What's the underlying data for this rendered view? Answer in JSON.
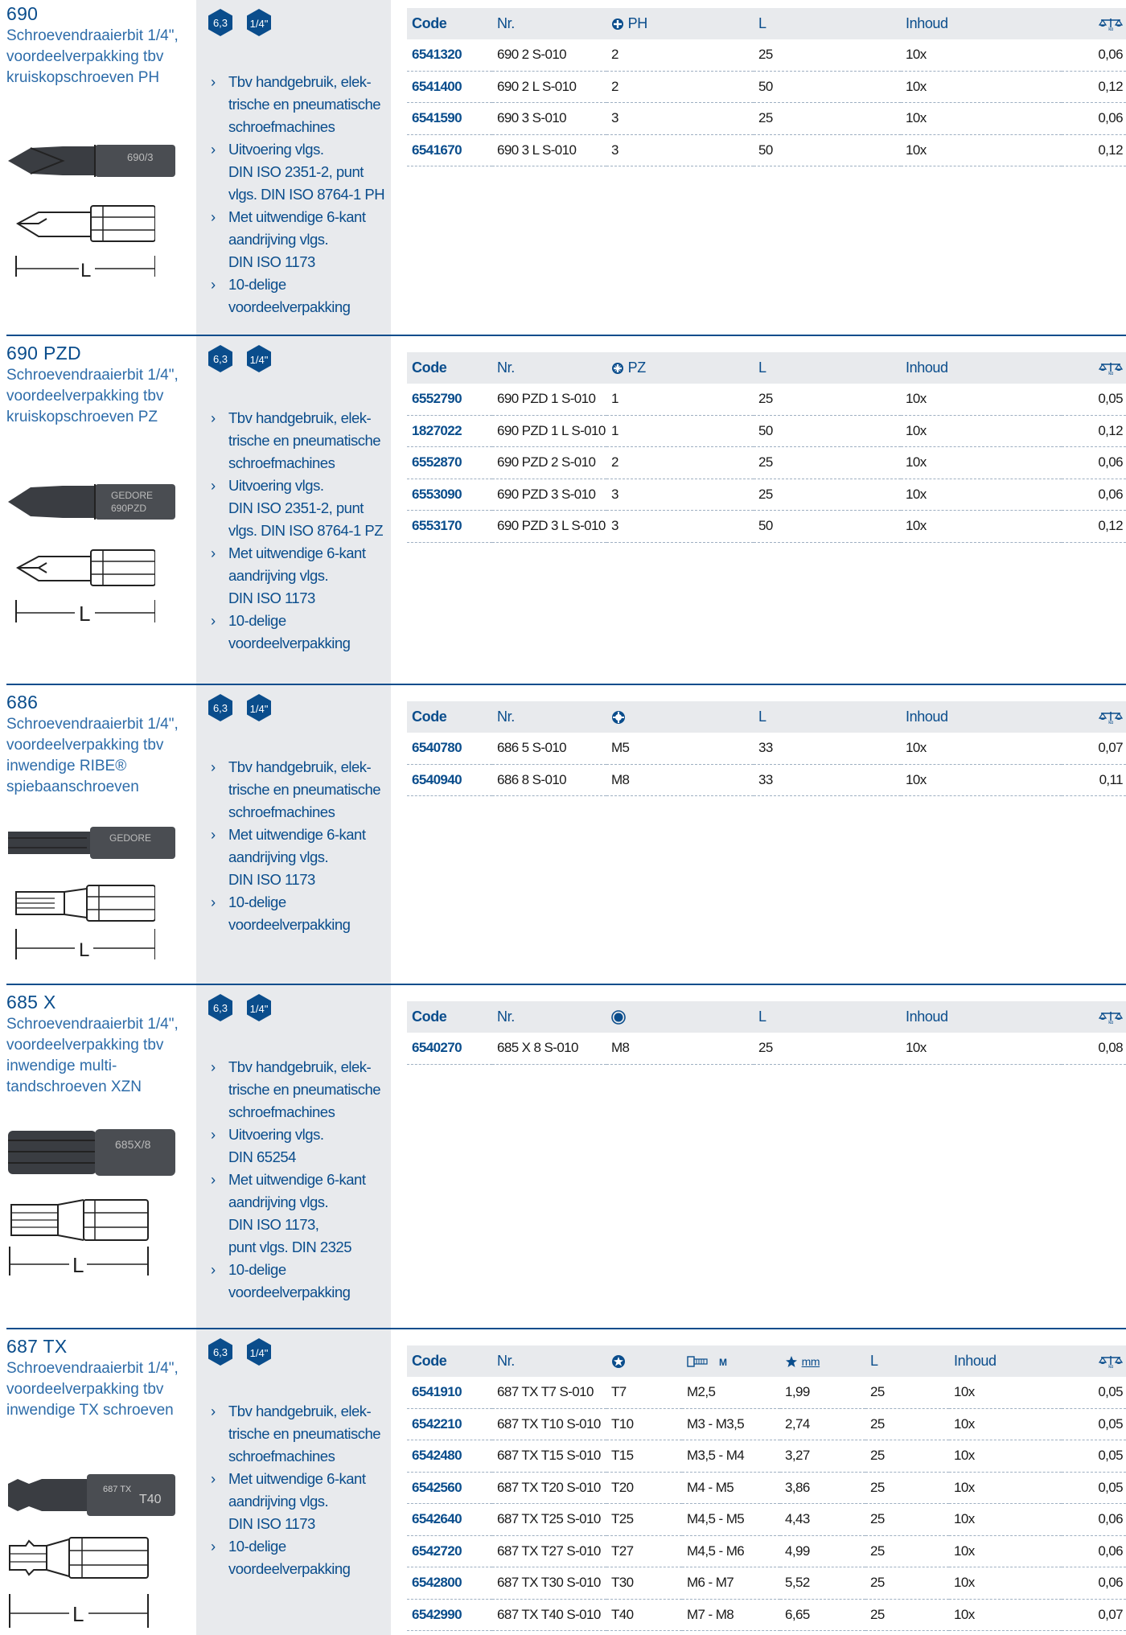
{
  "colors": {
    "brand_blue": "#0a4d8c",
    "panel_gray": "#e8eaed",
    "desc_blue": "#2d6ca9"
  },
  "sections": [
    {
      "title": "690",
      "description": "Schroevendraaierbit 1/4\", voordeelverpakking tbv kruiskopschroeven PH",
      "badges": [
        "6,3",
        "1/4\""
      ],
      "bullets": [
        "Tbv handgebruik, elek-\ntrische en pneumatische\nschroefmachines",
        "Uitvoering vlgs.\nDIN ISO 2351-2, punt\nvlgs. DIN ISO 8764-1 PH",
        "Met uitwendige 6-kant\naandrijving vlgs.\nDIN ISO 1173",
        "10-delige\nvoordeelverpakking"
      ],
      "drawing_label": "L",
      "headers": [
        "Code",
        "Nr.",
        "PH",
        "L",
        "Inhoud"
      ],
      "size_icon": "phillips-cross-icon",
      "weight_icon": "scale-kg-icon",
      "rows": [
        [
          "6541320",
          "690 2 S-010",
          "2",
          "25",
          "10x",
          "0,06"
        ],
        [
          "6541400",
          "690 2 L S-010",
          "2",
          "50",
          "10x",
          "0,12"
        ],
        [
          "6541590",
          "690 3 S-010",
          "3",
          "25",
          "10x",
          "0,06"
        ],
        [
          "6541670",
          "690 3 L S-010",
          "3",
          "50",
          "10x",
          "0,12"
        ]
      ]
    },
    {
      "title": "690 PZD",
      "description": "Schroevendraaierbit 1/4\", voordeelverpakking tbv kruiskopschroeven PZ",
      "badges": [
        "6,3",
        "1/4\""
      ],
      "bullets": [
        "Tbv handgebruik, elek-\ntrische en pneumatische\nschroefmachines",
        "Uitvoering vlgs.\nDIN ISO 2351-2, punt\nvlgs. DIN ISO 8764-1 PZ",
        "Met uitwendige 6-kant\naandrijving vlgs.\nDIN ISO 1173",
        "10-delige\nvoordeelverpakking"
      ],
      "drawing_label": "L",
      "headers": [
        "Code",
        "Nr.",
        "PZ",
        "L",
        "Inhoud"
      ],
      "size_icon": "pozidriv-cross-icon",
      "weight_icon": "scale-kg-icon",
      "rows": [
        [
          "6552790",
          "690 PZD 1 S-010",
          "1",
          "25",
          "10x",
          "0,05"
        ],
        [
          "1827022",
          "690 PZD 1 L S-010",
          "1",
          "50",
          "10x",
          "0,12"
        ],
        [
          "6552870",
          "690 PZD 2 S-010",
          "2",
          "25",
          "10x",
          "0,06"
        ],
        [
          "6553090",
          "690 PZD 3 S-010",
          "3",
          "25",
          "10x",
          "0,06"
        ],
        [
          "6553170",
          "690 PZD 3 L S-010",
          "3",
          "50",
          "10x",
          "0,12"
        ]
      ]
    },
    {
      "title": "686",
      "description": "Schroevendraaierbit 1/4\", voordeelverpakking tbv inwendige RIBE® spiebaanschroeven",
      "badges": [
        "6,3",
        "1/4\""
      ],
      "bullets": [
        "Tbv handgebruik, elek-\ntrische en pneumatische\nschroefmachines",
        "Met uitwendige 6-kant\naandrijving vlgs.\nDIN ISO 1173",
        "10-delige\nvoordeelverpakking"
      ],
      "drawing_label": "L",
      "headers": [
        "Code",
        "Nr.",
        "",
        "L",
        "Inhoud"
      ],
      "size_icon": "ribe-spline-icon",
      "weight_icon": "scale-kg-icon",
      "rows": [
        [
          "6540780",
          "686 5 S-010",
          "M5",
          "33",
          "10x",
          "0,07"
        ],
        [
          "6540940",
          "686 8 S-010",
          "M8",
          "33",
          "10x",
          "0,11"
        ]
      ]
    },
    {
      "title": "685 X",
      "description": "Schroevendraaierbit 1/4\", voordeelverpakking tbv inwendige multi-tandschroeven XZN",
      "badges": [
        "6,3",
        "1/4\""
      ],
      "bullets": [
        "Tbv handgebruik, elek-\ntrische en pneumatische\nschroefmachines",
        "Uitvoering vlgs.\nDIN 65254",
        "Met uitwendige 6-kant\naandrijving vlgs.\nDIN ISO 1173,\npunt vlgs. DIN 2325",
        "10-delige\nvoordeelverpakking"
      ],
      "drawing_label": "L",
      "headers": [
        "Code",
        "Nr.",
        "",
        "L",
        "Inhoud"
      ],
      "size_icon": "xzn-multitooth-icon",
      "weight_icon": "scale-kg-icon",
      "rows": [
        [
          "6540270",
          "685 X 8 S-010",
          "M8",
          "25",
          "10x",
          "0,08"
        ]
      ]
    },
    {
      "title": "687 TX",
      "description": "Schroevendraaierbit 1/4\", voordeelverpakking tbv inwendige TX schroeven",
      "badges": [
        "6,3",
        "1/4\""
      ],
      "bullets": [
        "Tbv handgebruik, elek-\ntrische en pneumatische\nschroefmachines",
        "Met uitwendige 6-kant\naandrijving vlgs.\nDIN ISO 1173",
        "10-delige\nvoordeelverpakking"
      ],
      "drawing_label": "L",
      "headers": [
        "Code",
        "Nr.",
        "",
        "M",
        "mm",
        "L",
        "Inhoud"
      ],
      "size_icon": "torx-star-icon",
      "thread_icon": "screw-thread-icon",
      "mm_icon": "torx-star-mm-icon",
      "weight_icon": "scale-kg-icon",
      "rows": [
        [
          "6541910",
          "687 TX T7 S-010",
          "T7",
          "M2,5",
          "1,99",
          "25",
          "10x",
          "0,05"
        ],
        [
          "6542210",
          "687 TX T10 S-010",
          "T10",
          "M3 - M3,5",
          "2,74",
          "25",
          "10x",
          "0,05"
        ],
        [
          "6542480",
          "687 TX T15 S-010",
          "T15",
          "M3,5 - M4",
          "3,27",
          "25",
          "10x",
          "0,05"
        ],
        [
          "6542560",
          "687 TX T20 S-010",
          "T20",
          "M4 - M5",
          "3,86",
          "25",
          "10x",
          "0,05"
        ],
        [
          "6542640",
          "687 TX T25 S-010",
          "T25",
          "M4,5 - M5",
          "4,43",
          "25",
          "10x",
          "0,06"
        ],
        [
          "6542720",
          "687 TX T27 S-010",
          "T27",
          "M4,5 - M6",
          "4,99",
          "25",
          "10x",
          "0,06"
        ],
        [
          "6542800",
          "687 TX T30 S-010",
          "T30",
          "M6 - M7",
          "5,52",
          "25",
          "10x",
          "0,06"
        ],
        [
          "6542990",
          "687 TX T40 S-010",
          "T40",
          "M7 - M8",
          "6,65",
          "25",
          "10x",
          "0,07"
        ]
      ]
    }
  ]
}
